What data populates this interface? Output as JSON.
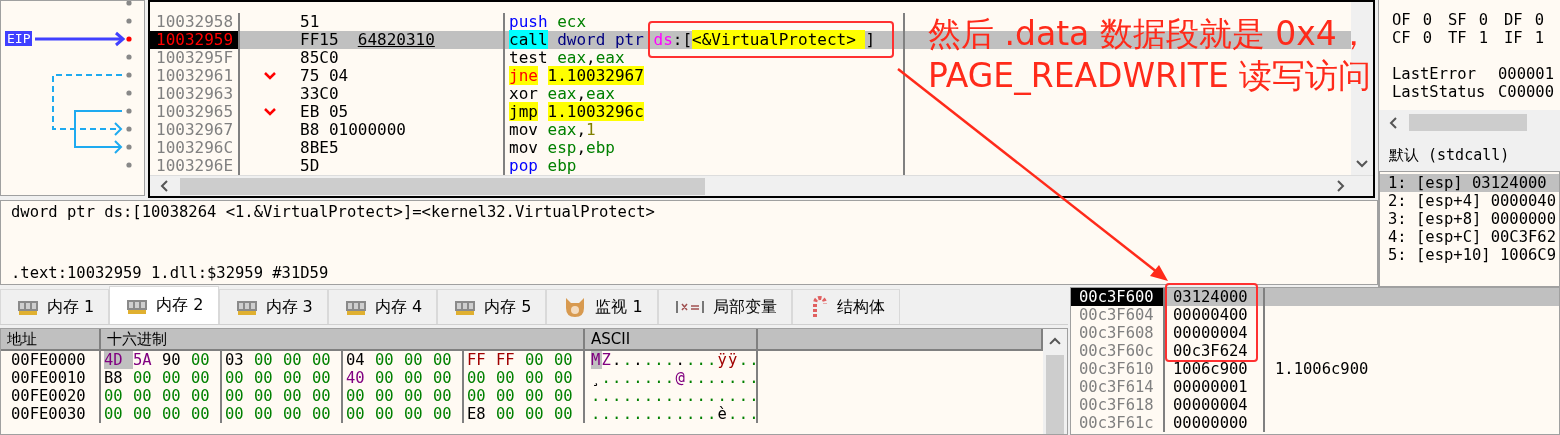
{
  "disassembly": {
    "eip_label": "EIP",
    "rows": [
      {
        "address": "10032958",
        "bytes": "51",
        "jump_mark": false,
        "selected": false,
        "parts": [
          {
            "text": "push",
            "kind": "stack"
          },
          {
            "text": " ecx",
            "kind": "register"
          }
        ]
      },
      {
        "address": "10032959",
        "bytes": "FF15",
        "bytes_operand": "64820310",
        "jump_mark": false,
        "selected": true,
        "parts": [
          {
            "text": "call",
            "kind": "call"
          },
          {
            "text": " dword ptr",
            "kind": "size"
          },
          {
            "text": " ds",
            "kind": "segment"
          },
          {
            "text": ":[",
            "kind": "plain"
          },
          {
            "text": "<&VirtualProtect> ",
            "kind": "symbol"
          },
          {
            "text": "]",
            "kind": "plain"
          }
        ]
      },
      {
        "address": "1003295F",
        "bytes": "85C0",
        "jump_mark": false,
        "selected": false,
        "parts": [
          {
            "text": "test",
            "kind": "mnemonic"
          },
          {
            "text": " eax",
            "kind": "register"
          },
          {
            "text": ",",
            "kind": "plain"
          },
          {
            "text": "eax",
            "kind": "register"
          }
        ]
      },
      {
        "address": "10032961",
        "bytes": "75 04",
        "jump_mark": true,
        "selected": false,
        "parts": [
          {
            "text": "jne",
            "kind": "condjump"
          },
          {
            "text": "1.10032967",
            "kind": "target"
          }
        ]
      },
      {
        "address": "10032963",
        "bytes": "33C0",
        "jump_mark": false,
        "selected": false,
        "parts": [
          {
            "text": "xor",
            "kind": "mnemonic"
          },
          {
            "text": " eax",
            "kind": "register"
          },
          {
            "text": ",",
            "kind": "plain"
          },
          {
            "text": "eax",
            "kind": "register"
          }
        ]
      },
      {
        "address": "10032965",
        "bytes": "EB 05",
        "jump_mark": true,
        "selected": false,
        "parts": [
          {
            "text": "jmp",
            "kind": "jump"
          },
          {
            "text": "1.1003296c",
            "kind": "target"
          }
        ]
      },
      {
        "address": "10032967",
        "bytes": "B8 01000000",
        "jump_mark": false,
        "selected": false,
        "parts": [
          {
            "text": "mov",
            "kind": "mnemonic"
          },
          {
            "text": " eax",
            "kind": "register"
          },
          {
            "text": ",",
            "kind": "plain"
          },
          {
            "text": "1",
            "kind": "number"
          }
        ]
      },
      {
        "address": "1003296C",
        "bytes": "8BE5",
        "jump_mark": false,
        "selected": false,
        "parts": [
          {
            "text": "mov",
            "kind": "mnemonic"
          },
          {
            "text": " esp",
            "kind": "register"
          },
          {
            "text": ",",
            "kind": "plain"
          },
          {
            "text": "ebp",
            "kind": "register"
          }
        ]
      },
      {
        "address": "1003296E",
        "bytes": "5D",
        "jump_mark": false,
        "selected": false,
        "parts": [
          {
            "text": "pop",
            "kind": "stack"
          },
          {
            "text": " ebp",
            "kind": "register"
          }
        ]
      }
    ]
  },
  "registers": {
    "flag_rows": [
      [
        {
          "name": "OF",
          "value": "0",
          "changed": false
        },
        {
          "name": "SF",
          "value": "0",
          "changed": false
        },
        {
          "name": "DF",
          "value": "0",
          "changed": false
        }
      ],
      [
        {
          "name": "CF",
          "value": "0",
          "changed": false
        },
        {
          "name": "TF",
          "value": "1",
          "changed": false
        },
        {
          "name": "IF",
          "value": "1",
          "changed": false
        }
      ]
    ],
    "values": [
      {
        "name": "LastError",
        "value": "000001"
      },
      {
        "name": "LastStatus",
        "value": "C00000"
      }
    ]
  },
  "call_args": {
    "title": "默认 (stdcall)",
    "items": [
      {
        "text": "1: [esp] 03124000",
        "selected": true
      },
      {
        "text": "2: [esp+4] 0000040",
        "selected": false
      },
      {
        "text": "3: [esp+8] 0000000",
        "selected": false
      },
      {
        "text": "4: [esp+C] 00C3F62",
        "selected": false
      },
      {
        "text": "5: [esp+10] 1006C9",
        "selected": false
      }
    ]
  },
  "info": {
    "lines": [
      "dword ptr ds:[10038264 <1.&VirtualProtect>]=<kernel32.VirtualProtect>",
      ".text:10032959 1.dll:$32959 #31D59"
    ]
  },
  "tabs": [
    {
      "label": "内存 1",
      "kind": "memory",
      "selected": false
    },
    {
      "label": "内存 2",
      "kind": "memory",
      "selected": true
    },
    {
      "label": "内存 3",
      "kind": "memory",
      "selected": false
    },
    {
      "label": "内存 4",
      "kind": "memory",
      "selected": false
    },
    {
      "label": "内存 5",
      "kind": "memory",
      "selected": false
    },
    {
      "label": "监视 1",
      "kind": "watch",
      "selected": false
    },
    {
      "label": "局部变量",
      "kind": "locals",
      "selected": false
    },
    {
      "label": "结构体",
      "kind": "struct",
      "selected": false
    }
  ],
  "hex_dump": {
    "columns": [
      "地址",
      "十六进制",
      "ASCII"
    ],
    "rows": [
      {
        "address": "00FE0000",
        "ascii": "MZ..........ÿÿ..",
        "bytes": [
          {
            "text": "4D",
            "kind": "printable",
            "selected": true
          },
          {
            "text": "5A",
            "kind": "printable",
            "selected": false
          },
          {
            "text": "90",
            "kind": "other",
            "selected": false
          },
          {
            "text": "00",
            "kind": "zero",
            "selected": false
          },
          {
            "text": "03",
            "kind": "other",
            "selected": false
          },
          {
            "text": "00",
            "kind": "zero",
            "selected": false
          },
          {
            "text": "00",
            "kind": "zero",
            "selected": false
          },
          {
            "text": "00",
            "kind": "zero",
            "selected": false
          },
          {
            "text": "04",
            "kind": "other",
            "selected": false
          },
          {
            "text": "00",
            "kind": "zero",
            "selected": false
          },
          {
            "text": "00",
            "kind": "zero",
            "selected": false
          },
          {
            "text": "00",
            "kind": "zero",
            "selected": false
          },
          {
            "text": "FF",
            "kind": "high",
            "selected": false
          },
          {
            "text": "FF",
            "kind": "high",
            "selected": false
          },
          {
            "text": "00",
            "kind": "zero",
            "selected": false
          },
          {
            "text": "00",
            "kind": "zero",
            "selected": false
          }
        ]
      },
      {
        "address": "00FE0010",
        "ascii": "¸.......@.......",
        "bytes": [
          {
            "text": "B8",
            "kind": "other",
            "selected": false
          },
          {
            "text": "00",
            "kind": "zero",
            "selected": false
          },
          {
            "text": "00",
            "kind": "zero",
            "selected": false
          },
          {
            "text": "00",
            "kind": "zero",
            "selected": false
          },
          {
            "text": "00",
            "kind": "zero",
            "selected": false
          },
          {
            "text": "00",
            "kind": "zero",
            "selected": false
          },
          {
            "text": "00",
            "kind": "zero",
            "selected": false
          },
          {
            "text": "00",
            "kind": "zero",
            "selected": false
          },
          {
            "text": "40",
            "kind": "printable",
            "selected": false
          },
          {
            "text": "00",
            "kind": "zero",
            "selected": false
          },
          {
            "text": "00",
            "kind": "zero",
            "selected": false
          },
          {
            "text": "00",
            "kind": "zero",
            "selected": false
          },
          {
            "text": "00",
            "kind": "zero",
            "selected": false
          },
          {
            "text": "00",
            "kind": "zero",
            "selected": false
          },
          {
            "text": "00",
            "kind": "zero",
            "selected": false
          },
          {
            "text": "00",
            "kind": "zero",
            "selected": false
          }
        ]
      },
      {
        "address": "00FE0020",
        "ascii": "................",
        "bytes": [
          {
            "text": "00",
            "kind": "zero",
            "selected": false
          },
          {
            "text": "00",
            "kind": "zero",
            "selected": false
          },
          {
            "text": "00",
            "kind": "zero",
            "selected": false
          },
          {
            "text": "00",
            "kind": "zero",
            "selected": false
          },
          {
            "text": "00",
            "kind": "zero",
            "selected": false
          },
          {
            "text": "00",
            "kind": "zero",
            "selected": false
          },
          {
            "text": "00",
            "kind": "zero",
            "selected": false
          },
          {
            "text": "00",
            "kind": "zero",
            "selected": false
          },
          {
            "text": "00",
            "kind": "zero",
            "selected": false
          },
          {
            "text": "00",
            "kind": "zero",
            "selected": false
          },
          {
            "text": "00",
            "kind": "zero",
            "selected": false
          },
          {
            "text": "00",
            "kind": "zero",
            "selected": false
          },
          {
            "text": "00",
            "kind": "zero",
            "selected": false
          },
          {
            "text": "00",
            "kind": "zero",
            "selected": false
          },
          {
            "text": "00",
            "kind": "zero",
            "selected": false
          },
          {
            "text": "00",
            "kind": "zero",
            "selected": false
          }
        ]
      },
      {
        "address": "00FE0030",
        "ascii": "............è...",
        "bytes": [
          {
            "text": "00",
            "kind": "zero",
            "selected": false
          },
          {
            "text": "00",
            "kind": "zero",
            "selected": false
          },
          {
            "text": "00",
            "kind": "zero",
            "selected": false
          },
          {
            "text": "00",
            "kind": "zero",
            "selected": false
          },
          {
            "text": "00",
            "kind": "zero",
            "selected": false
          },
          {
            "text": "00",
            "kind": "zero",
            "selected": false
          },
          {
            "text": "00",
            "kind": "zero",
            "selected": false
          },
          {
            "text": "00",
            "kind": "zero",
            "selected": false
          },
          {
            "text": "00",
            "kind": "zero",
            "selected": false
          },
          {
            "text": "00",
            "kind": "zero",
            "selected": false
          },
          {
            "text": "00",
            "kind": "zero",
            "selected": false
          },
          {
            "text": "00",
            "kind": "zero",
            "selected": false
          },
          {
            "text": "E8",
            "kind": "other",
            "selected": false
          },
          {
            "text": "00",
            "kind": "zero",
            "selected": false
          },
          {
            "text": "00",
            "kind": "zero",
            "selected": false
          },
          {
            "text": "00",
            "kind": "zero",
            "selected": false
          }
        ]
      }
    ]
  },
  "stack": {
    "rows": [
      {
        "address": "00c3F600",
        "value": "03124000",
        "selected": true
      },
      {
        "address": "00c3F604",
        "value": "00000400",
        "selected": false
      },
      {
        "address": "00c3F608",
        "value": "00000004",
        "selected": false
      },
      {
        "address": "00c3F60c",
        "value": "00c3F624",
        "selected": false
      },
      {
        "address": "00c3F610",
        "value": "1006c900",
        "comment": "1.1006c900",
        "selected": false
      },
      {
        "address": "00c3F614",
        "value": "00000001",
        "selected": false
      },
      {
        "address": "00c3F618",
        "value": "00000004",
        "selected": false
      },
      {
        "address": "00c3F61c",
        "value": "00000000",
        "selected": false
      }
    ]
  },
  "annotation": {
    "lines": [
      "然后 .data 数据段就是 0x4，",
      "PAGE_READWRITE 读写访问"
    ]
  }
}
